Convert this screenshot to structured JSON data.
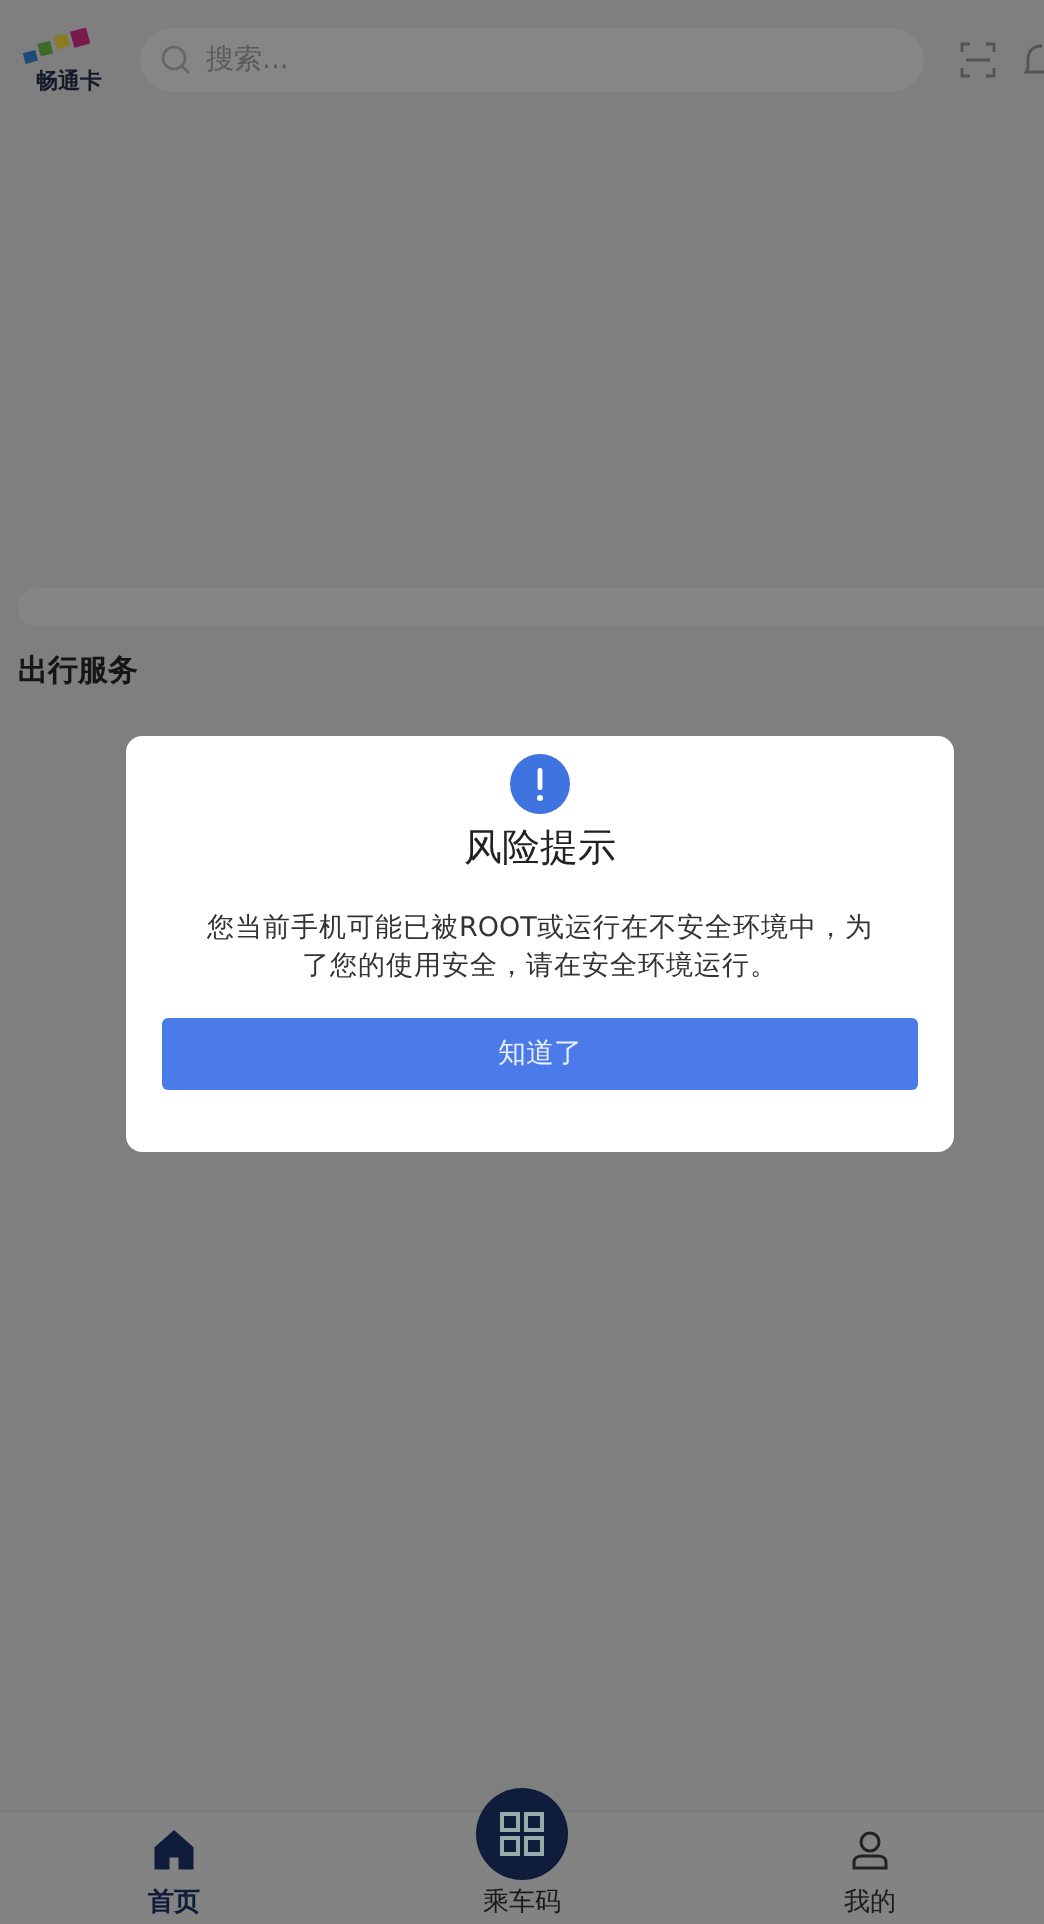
{
  "header": {
    "logo_text": "畅通卡",
    "search": {
      "placeholder": "搜索..."
    }
  },
  "section_title": "出行服务",
  "dialog": {
    "title": "风险提示",
    "message": "您当前手机可能已被ROOT或运行在不安全环境中，为了您的使用安全，请在安全环境运行。",
    "button": "知道了"
  },
  "tab_bar": [
    {
      "label": "首页",
      "kind": "home",
      "selected": true
    },
    {
      "label": "乘车码",
      "kind": "qr",
      "selected": false
    },
    {
      "label": "我的",
      "kind": "profile",
      "selected": false
    }
  ]
}
